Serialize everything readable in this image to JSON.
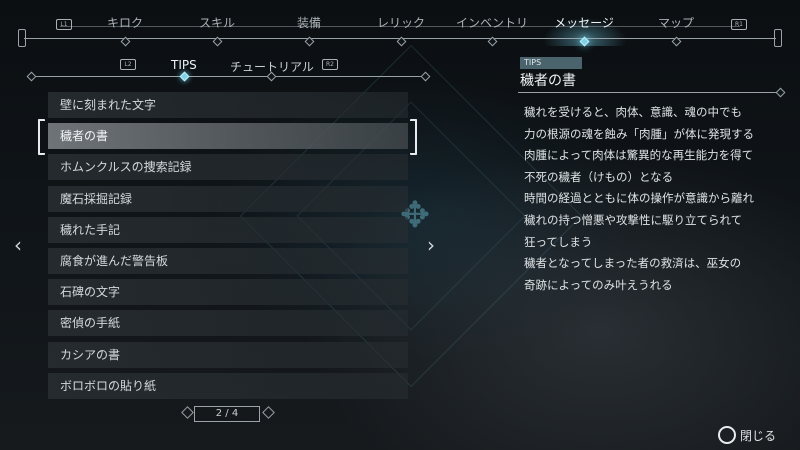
{
  "nav": {
    "left_button": "L1",
    "right_button": "R1",
    "tabs": [
      {
        "label": "キロク",
        "active": false
      },
      {
        "label": "スキル",
        "active": false
      },
      {
        "label": "装備",
        "active": false
      },
      {
        "label": "レリック",
        "active": false
      },
      {
        "label": "インベントリ",
        "active": false
      },
      {
        "label": "メッセージ",
        "active": true
      },
      {
        "label": "マップ",
        "active": false
      }
    ]
  },
  "subtabs": {
    "left_button": "L2",
    "right_button": "R2",
    "items": [
      {
        "label": "TIPS",
        "active": true
      },
      {
        "label": "チュートリアル",
        "active": false
      }
    ]
  },
  "list": {
    "items": [
      {
        "label": "壁に刻まれた文字",
        "selected": false
      },
      {
        "label": "穢者の書",
        "selected": true
      },
      {
        "label": "ホムンクルスの捜索記録",
        "selected": false
      },
      {
        "label": "魔石採掘記録",
        "selected": false
      },
      {
        "label": "穢れた手記",
        "selected": false
      },
      {
        "label": "腐食が進んだ警告板",
        "selected": false
      },
      {
        "label": "石碑の文字",
        "selected": false
      },
      {
        "label": "密偵の手紙",
        "selected": false
      },
      {
        "label": "カシアの書",
        "selected": false
      },
      {
        "label": "ボロボロの貼り紙",
        "selected": false
      }
    ],
    "left_arrow": "‹",
    "right_arrow": "›"
  },
  "pager": {
    "text": "2 / 4"
  },
  "detail": {
    "category": "TIPS",
    "title": "穢者の書",
    "lines": [
      "穢れを受けると、肉体、意識、魂の中でも",
      "力の根源の魂を蝕み「肉腫」が体に発現する",
      "肉腫によって肉体は驚異的な再生能力を得て",
      "不死の穢者（けもの）となる",
      "時間の経過とともに体の操作が意識から離れ",
      "穢れの持つ憎悪や攻撃性に駆り立てられて",
      "狂ってしまう",
      "穢者となってしまった者の救済は、巫女の",
      "奇跡によってのみ叶えうれる"
    ]
  },
  "footer": {
    "close_label": "閉じる"
  }
}
